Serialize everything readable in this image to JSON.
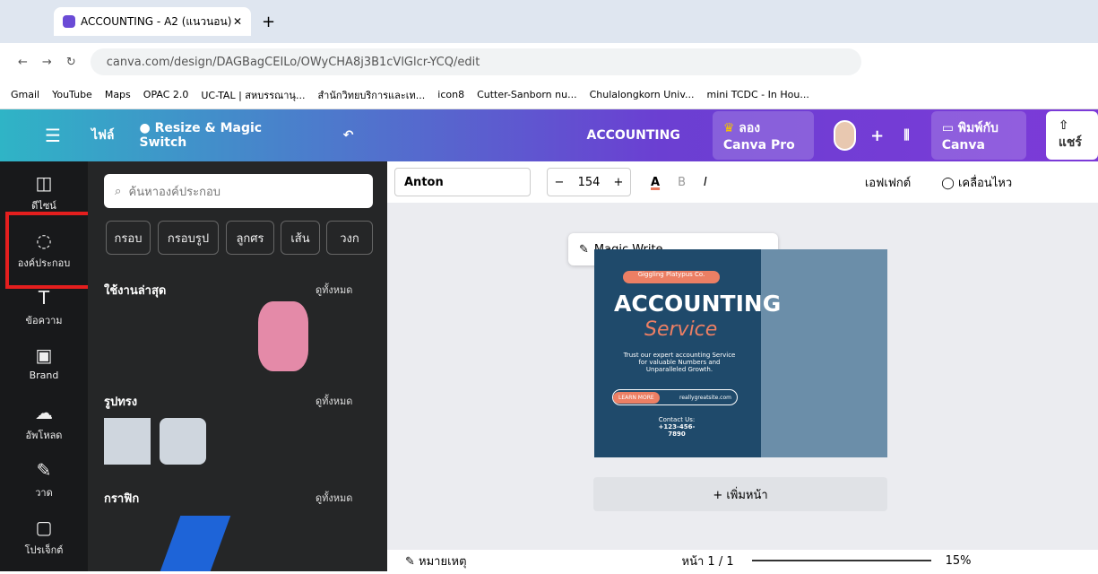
{
  "tab": "ACCOUNTING - A2 (แนวนอน)",
  "url": "canva.com/design/DAGBagCEILo/OWyCHA8j3B1cVlGlcr-YCQ/edit",
  "bookmarks": [
    "Gmail",
    "YouTube",
    "Maps",
    "OPAC 2.0",
    "UC-TAL | สหบรรณานุ...",
    "สำนักวิทยบริการและเท...",
    "icon8",
    "Cutter-Sanborn nu...",
    "Chulalongkorn Univ...",
    "mini TCDC - In Hou..."
  ],
  "top": {
    "file": "ไฟล์",
    "resize": "Resize & Magic Switch",
    "title": "ACCOUNTING",
    "pro": "ลอง Canva Pro",
    "print": "พิมพ์กับ Canva",
    "share": "แชร์"
  },
  "rail": [
    "ดีไซน์",
    "องค์ประกอบ",
    "ข้อความ",
    "Brand",
    "อัพโหลด",
    "วาด",
    "โปรเจ็กต์"
  ],
  "search": "ค้นหาองค์ประกอบ",
  "cats": [
    "กรอบ",
    "กรอบรูป",
    "ลูกศร",
    "เส้น",
    "วงก"
  ],
  "sec": [
    "ใช้งานล่าสุด",
    "รูปทรง",
    "กราฟิก"
  ],
  "all": "ดูทั้งหมด",
  "fmt": {
    "font": "Anton",
    "size": "154",
    "effects": "เอฟเฟกต์",
    "anim": "เคลื่อนไหว"
  },
  "magic": "Magic Write",
  "card": {
    "brand": "Giggling Platypus Co.",
    "h": "ACCOUNTING",
    "s": "Service",
    "p": "Trust our expert accounting Service for valuable Numbers and Unparalleled Growth.",
    "btn": "LEARN MORE",
    "site": "reallygreatsite.com",
    "contact": "Contact Us:",
    "phone": "+123-456-7890"
  },
  "add": "+ เพิ่มหน้า",
  "notes": "หมายเหตุ",
  "page": "หน้า 1 / 1",
  "zoom": "15%"
}
